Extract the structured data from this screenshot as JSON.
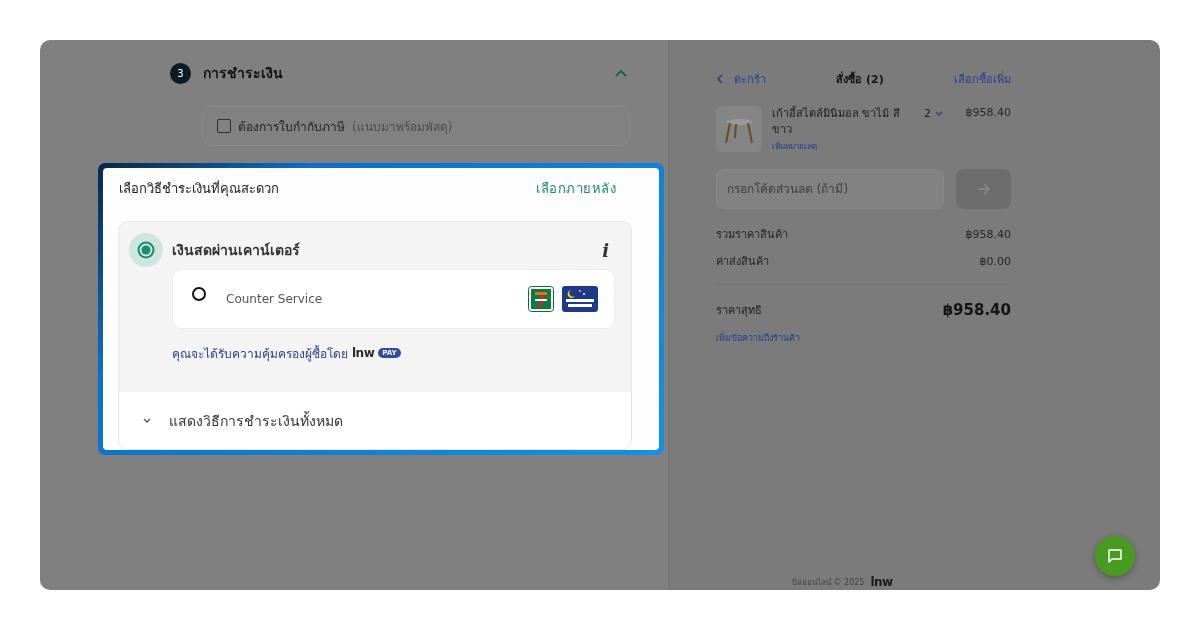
{
  "checkout_step": {
    "number": "3",
    "title": "การชำระเงิน",
    "expanded": true,
    "tax_invoice": {
      "label": "ต้องการใบกำกับภาษี",
      "hint": "(แนบมาพร้อมพัสดุ)",
      "checked": false
    }
  },
  "payment_dialog": {
    "title": "เลือกวิธีชำระเงินที่คุณสะดวก",
    "later_link": "เลือกภายหลัง",
    "methods": [
      {
        "label": "เงินสดผ่านเคาน์เตอร์",
        "selected": true,
        "info": "i",
        "options": [
          {
            "label": "Counter Service",
            "selected": false
          }
        ],
        "protection": {
          "text": "คุณจะได้รับความคุ้มครองผู้ซื้อโดย",
          "brand": "lnw",
          "badge": "PAY"
        }
      }
    ],
    "show_all": "แสดงวิธีการชำระเงินทั้งหมด"
  },
  "order": {
    "back_link": "ตะกร้า",
    "title": "สั่งซื้อ (2)",
    "more_link": "เลือกซื้อเพิ่ม",
    "items": [
      {
        "name": "เก้าอี้สไตล์มินิมอล ขาไม้ สีขาว",
        "quantity": "2",
        "price": "฿958.40",
        "note_link": "เพิ่มหมายเหตุ"
      }
    ],
    "coupon": {
      "placeholder": "กรอกโค้ดส่วนลด (ถ้ามี)"
    },
    "summary": [
      {
        "label": "รวมราคาสินค้า",
        "value": "฿958.40"
      },
      {
        "label": "ค่าส่งสินค้า",
        "value": "฿0.00"
      }
    ],
    "total": {
      "label": "ราคาสุทธิ",
      "value": "฿958.40"
    },
    "message_link": "เพิ่มข้อความถึงร้านค้า"
  },
  "footer": {
    "text": "บิลออนไลน์ © 2025",
    "brand": "lnw"
  }
}
